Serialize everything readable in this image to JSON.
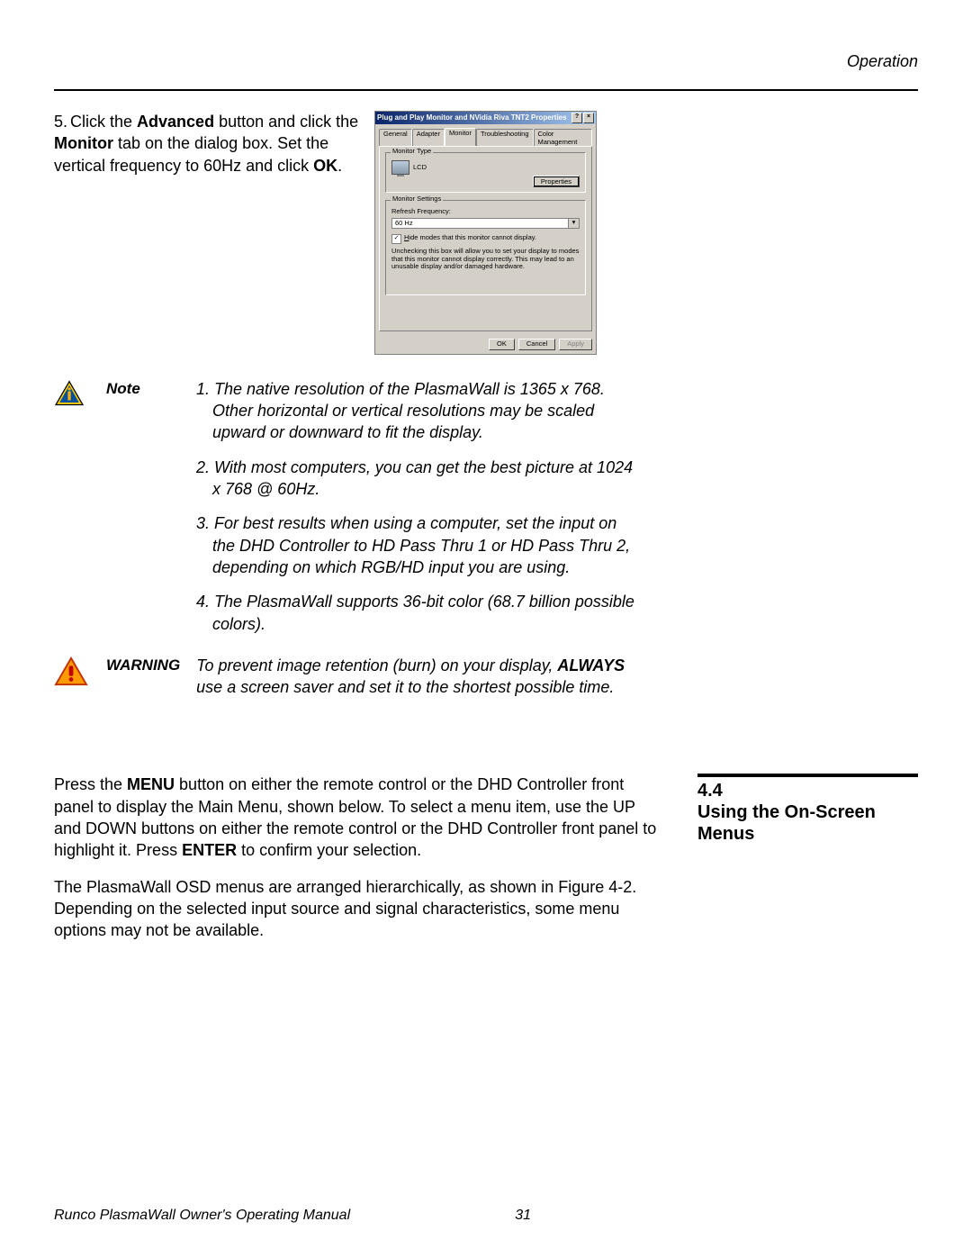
{
  "header": {
    "section": "Operation"
  },
  "step": {
    "num": "5.",
    "pre": "Click the ",
    "b1": "Advanced",
    "mid1": " button and click the ",
    "b2": "Monitor",
    "mid2": " tab on the dialog box. Set the vertical frequency to 60Hz and click ",
    "b3": "OK",
    "end": "."
  },
  "dialog": {
    "title": "Plug and Play Monitor and NVidia Riva TNT2 Properties",
    "help_btn": "?",
    "close_btn": "×",
    "tabs": {
      "general": "General",
      "adapter": "Adapter",
      "monitor": "Monitor",
      "troubleshooting": "Troubleshooting",
      "colormgmt": "Color Management"
    },
    "group1_title": "Monitor Type",
    "monitor_type_val": "LCD",
    "properties_btn": "Properties",
    "group2_title": "Monitor Settings",
    "refresh_label": "Refresh Frequency:",
    "refresh_val": "60 Hz",
    "hide_label_pre": "H",
    "hide_label_rest": "ide modes that this monitor cannot display.",
    "hide_desc": "Unchecking this box will allow you to set your display to modes that this monitor cannot display correctly. This may lead to an unusable display and/or damaged hardware.",
    "ok_btn": "OK",
    "cancel_btn": "Cancel",
    "apply_btn": "Apply"
  },
  "note": {
    "label": "Note",
    "items": [
      "1. The native resolution of the PlasmaWall is 1365 x 768. Other horizontal or vertical resolutions may be scaled upward or downward to fit the display.",
      "2. With most computers, you can get the best picture at 1024 x 768 @ 60Hz.",
      "3. For best results when using a computer, set the input on the DHD Controller to HD Pass Thru 1 or HD Pass Thru 2, depending on which RGB/HD input you are using.",
      "4. The PlasmaWall supports 36-bit color (68.7 billion possible colors)."
    ]
  },
  "warning": {
    "label": "WARNING",
    "pre": "To prevent image retention (burn) on your display, ",
    "bold": "ALWAYS",
    "post": " use a screen saver and set it to the shortest possible time."
  },
  "section": {
    "num": "4.4",
    "title": "Using the On-Screen Menus"
  },
  "body": {
    "p1_pre": "Press the ",
    "p1_b1": "MENU",
    "p1_mid": " button on either the remote control or the DHD Controller front panel to display the Main Menu, shown below. To select a menu item, use the UP and DOWN buttons on either the remote control or the DHD Controller front panel to highlight it. Press ",
    "p1_b2": "ENTER",
    "p1_end": " to confirm your selection.",
    "p2": "The PlasmaWall OSD menus are arranged hierarchically, as shown in Figure 4-2. Depending on the selected input source and signal characteristics, some menu options may not be available."
  },
  "footer": {
    "left": "Runco PlasmaWall Owner's Operating Manual",
    "page": "31"
  }
}
